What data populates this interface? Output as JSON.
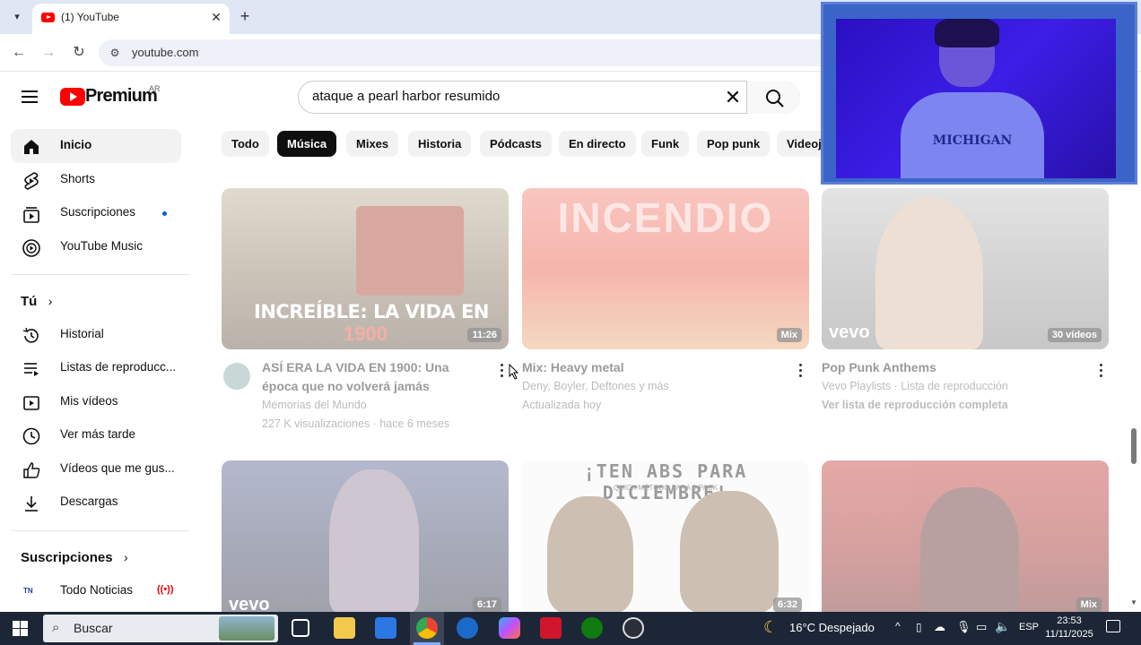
{
  "browser": {
    "tab_title": "(1) YouTube",
    "url": "youtube.com"
  },
  "header": {
    "logo_text": "Premium",
    "logo_country": "AR",
    "search_value": "ataque a pearl harbor resumido"
  },
  "sidebar": {
    "main": [
      {
        "label": "Inicio",
        "icon": "home-icon"
      },
      {
        "label": "Shorts",
        "icon": "shorts-icon"
      },
      {
        "label": "Suscripciones",
        "icon": "subscriptions-icon"
      },
      {
        "label": "YouTube Music",
        "icon": "youtube-music-icon"
      }
    ],
    "you_heading": "Tú",
    "you": [
      {
        "label": "Historial",
        "icon": "history-icon"
      },
      {
        "label": "Listas de reproducc...",
        "icon": "playlists-icon"
      },
      {
        "label": "Mis vídeos",
        "icon": "my-videos-icon"
      },
      {
        "label": "Ver más tarde",
        "icon": "watch-later-icon"
      },
      {
        "label": "Vídeos que me gus...",
        "icon": "liked-icon"
      },
      {
        "label": "Descargas",
        "icon": "download-icon"
      }
    ],
    "subs_heading": "Suscripciones",
    "subs": [
      {
        "label": "Todo Noticias",
        "icon": "tn-channel-icon"
      }
    ]
  },
  "chips": [
    "Todo",
    "Música",
    "Mixes",
    "Historia",
    "Pódcasts",
    "En directo",
    "Funk",
    "Pop punk",
    "Videoj"
  ],
  "videos_row1": [
    {
      "title_line1": "ASÍ ERA LA VIDA EN 1900: Una",
      "title_line2": "época que no volverá jamás",
      "meta1": "Memorias del Mundo",
      "meta2": "227 K visualizaciones · hace 6 meses",
      "badge": "11:26",
      "thumb_text1": "INCREÍBLE: LA VIDA EN",
      "thumb_text2": "1900"
    },
    {
      "title_line1": "Mix: Heavy metal",
      "meta1": "Deny, Boyler, Deftones y más",
      "meta2": "Actualizada hoy",
      "badge": "Mix"
    },
    {
      "title_line1": "Pop Punk Anthems",
      "meta1": "Vevo Playlists · Lista de reproducción",
      "meta2": "Ver lista de reproducción completa",
      "badge": "30 vídeos",
      "thumb_text1": "vevo"
    }
  ],
  "videos_row2": [
    {
      "badge": "6:17",
      "thumb_text1": "vevo"
    },
    {
      "badge": "6:32",
      "thumb_text1": "¡TEN ABS PARA DICIEMBRE!",
      "thumb_text2": "QUICK MÉTODO PARA 6-PACK"
    },
    {
      "badge": "Mix"
    }
  ],
  "webcam": {
    "shirt_text": "MICHIGAN"
  },
  "taskbar": {
    "search_placeholder": "Buscar",
    "weather": "16°C  Despejado",
    "lang": "ESP",
    "time": "23:53",
    "date": "11/11/2025"
  }
}
